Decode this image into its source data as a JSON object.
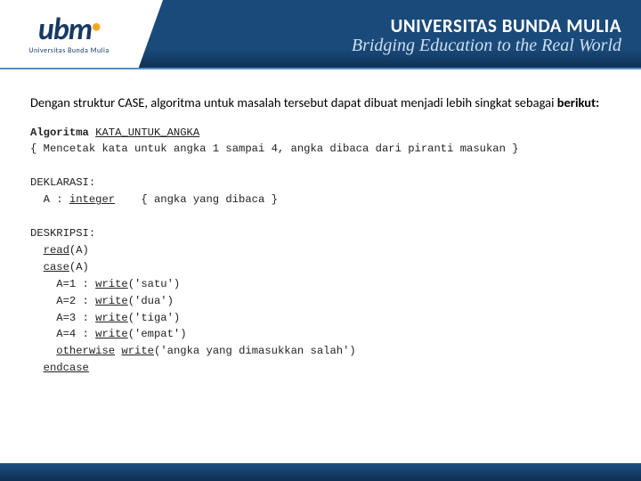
{
  "header": {
    "logo_main": "ubm",
    "logo_dot": "•",
    "logo_sub": "Universitas Bunda Mulia",
    "university": "UNIVERSITAS BUNDA MULIA",
    "tagline": "Bridging Education to the Real World"
  },
  "intro": {
    "part1": "Dengan struktur CASE, algoritma untuk masalah tersebut dapat dibuat  menjadi lebih singkat sebagai ",
    "bold": "berikut:"
  },
  "algo": {
    "title_kw": "Algoritma",
    "title_name": "KATA_UNTUK_ANGKA",
    "comment_top": "{ Mencetak kata untuk angka 1 sampai 4, angka dibaca dari piranti masukan }",
    "deklarasi": "DEKLARASI:",
    "decl_line_pre": "  A : ",
    "decl_type": "integer",
    "decl_comment": "    { angka yang dibaca }",
    "deskripsi": "DESKRIPSI:",
    "read_indent": "  ",
    "read_kw": "read",
    "read_arg": "(A)",
    "case_indent": "  ",
    "case_kw": "case",
    "case_arg": "(A)",
    "c1_pre": "    A=1 : ",
    "c2_pre": "    A=2 : ",
    "c3_pre": "    A=3 : ",
    "c4_pre": "    A=4 : ",
    "ow_pre": "    ",
    "write_kw": "write",
    "c1_arg": "('satu')",
    "c2_arg": "('dua')",
    "c3_arg": "('tiga')",
    "c4_arg": "('empat')",
    "ow_kw": "otherwise",
    "ow_arg": "('angka yang dimasukkan salah')",
    "endcase_indent": "  ",
    "endcase": "endcase"
  }
}
